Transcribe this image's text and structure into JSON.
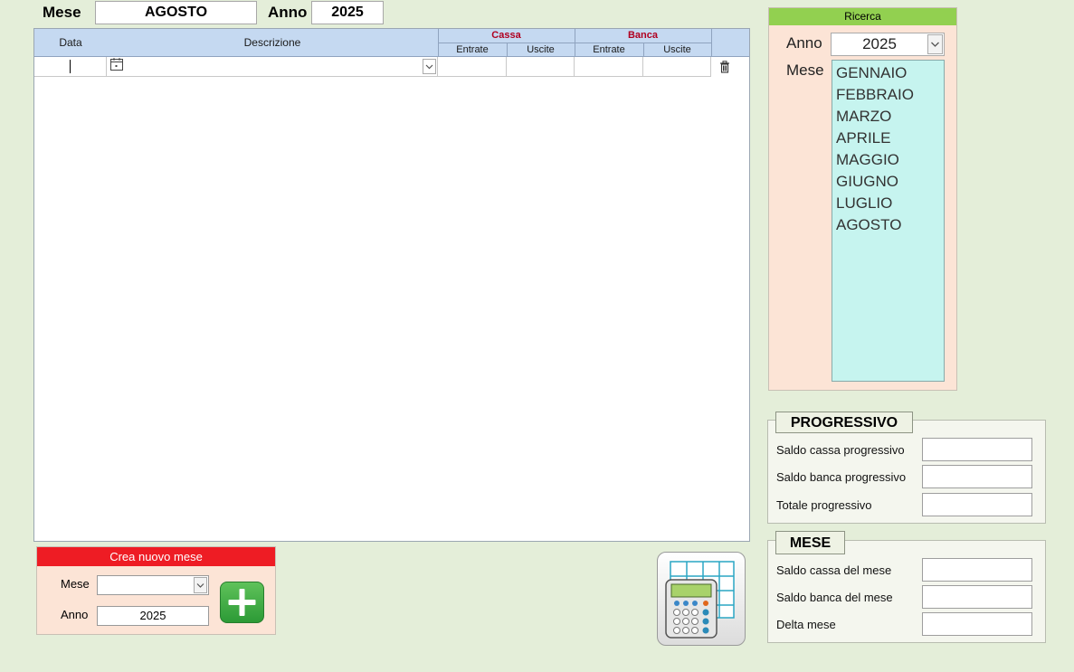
{
  "header": {
    "mese_label": "Mese",
    "mese_value": "AGOSTO",
    "anno_label": "Anno",
    "anno_value": "2025"
  },
  "grid": {
    "col_data": "Data",
    "col_descrizione": "Descrizione",
    "group_cassa": "Cassa",
    "group_banca": "Banca",
    "sub_entrate": "Entrate",
    "sub_uscite": "Uscite"
  },
  "ricerca": {
    "title": "Ricerca",
    "anno_label": "Anno",
    "anno_value": "2025",
    "mese_label": "Mese",
    "months": [
      "GENNAIO",
      "FEBBRAIO",
      "MARZO",
      "APRILE",
      "MAGGIO",
      "GIUGNO",
      "LUGLIO",
      "AGOSTO"
    ]
  },
  "progressivo": {
    "title": "PROGRESSIVO",
    "rows": [
      "Saldo cassa progressivo",
      "Saldo banca progressivo",
      "Totale progressivo"
    ]
  },
  "mese_group": {
    "title": "MESE",
    "rows": [
      "Saldo cassa del mese",
      "Saldo banca del mese",
      "Delta mese"
    ]
  },
  "crea": {
    "title": "Crea nuovo mese",
    "mese_label": "Mese",
    "anno_label": "Anno",
    "anno_value": "2025"
  },
  "colors": {
    "accent_green": "#92d050",
    "accent_red": "#ee1c24",
    "header_blue": "#c5d9f1",
    "list_cyan": "#c6f4ef"
  },
  "icons": [
    "calendar-icon",
    "trash-icon",
    "chevron-down-icon",
    "plus-icon",
    "calculator-icon"
  ]
}
